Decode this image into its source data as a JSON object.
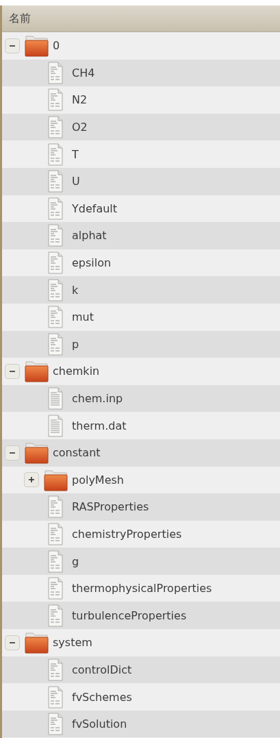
{
  "header": {
    "label": "名前"
  },
  "tree": [
    {
      "name": "0",
      "kind": "folder",
      "expanded": true,
      "children": [
        {
          "name": "CH4",
          "kind": "file"
        },
        {
          "name": "N2",
          "kind": "file"
        },
        {
          "name": "O2",
          "kind": "file"
        },
        {
          "name": "T",
          "kind": "file"
        },
        {
          "name": "U",
          "kind": "file"
        },
        {
          "name": "Ydefault",
          "kind": "file"
        },
        {
          "name": "alphat",
          "kind": "file"
        },
        {
          "name": "epsilon",
          "kind": "file"
        },
        {
          "name": "k",
          "kind": "file"
        },
        {
          "name": "mut",
          "kind": "file"
        },
        {
          "name": "p",
          "kind": "file"
        }
      ]
    },
    {
      "name": "chemkin",
      "kind": "folder",
      "expanded": true,
      "children": [
        {
          "name": "chem.inp",
          "kind": "text"
        },
        {
          "name": "therm.dat",
          "kind": "text"
        }
      ]
    },
    {
      "name": "constant",
      "kind": "folder",
      "expanded": true,
      "children": [
        {
          "name": "polyMesh",
          "kind": "folder",
          "expanded": false
        },
        {
          "name": "RASProperties",
          "kind": "file"
        },
        {
          "name": "chemistryProperties",
          "kind": "file"
        },
        {
          "name": "g",
          "kind": "file"
        },
        {
          "name": "thermophysicalProperties",
          "kind": "file"
        },
        {
          "name": "turbulenceProperties",
          "kind": "file"
        }
      ]
    },
    {
      "name": "system",
      "kind": "folder",
      "expanded": true,
      "children": [
        {
          "name": "controlDict",
          "kind": "file"
        },
        {
          "name": "fvSchemes",
          "kind": "file"
        },
        {
          "name": "fvSolution",
          "kind": "file"
        }
      ]
    }
  ]
}
